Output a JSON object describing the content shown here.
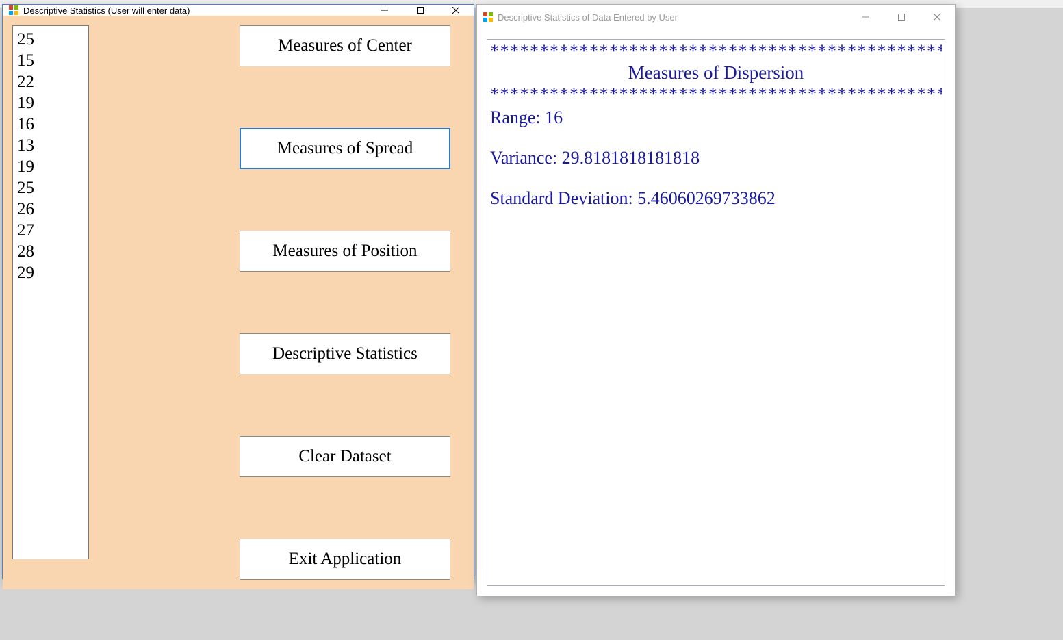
{
  "window1": {
    "title": "Descriptive Statistics (User will enter data)",
    "data_values": [
      "25",
      "15",
      "22",
      "19",
      "16",
      "13",
      "19",
      "25",
      "26",
      "27",
      "28",
      "29"
    ],
    "buttons": {
      "center": "Measures of Center",
      "spread": "Measures of Spread",
      "position": "Measures of Position",
      "desc": "Descriptive Statistics",
      "clear": "Clear Dataset",
      "exit": "Exit Application"
    }
  },
  "window2": {
    "title": "Descriptive Statistics of Data Entered by User",
    "separator": "**********************************************",
    "heading": "Measures of Dispersion",
    "results": {
      "range_label": "Range: ",
      "range_value": "16",
      "variance_label": "Variance: ",
      "variance_value": "29.8181818181818",
      "stddev_label": "Standard Deviation: ",
      "stddev_value": "5.46060269733862"
    }
  },
  "winctrls": {
    "min": "—",
    "max": "☐",
    "close": "✕"
  }
}
